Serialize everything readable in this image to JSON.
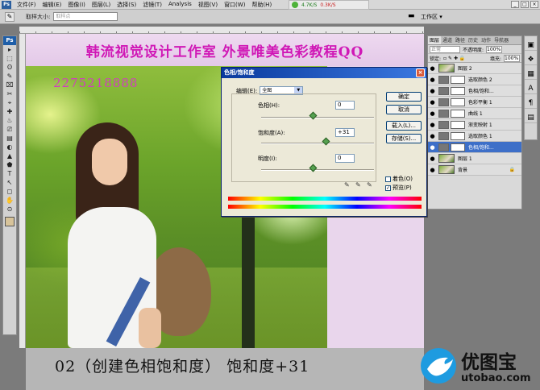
{
  "menubar": {
    "ps_icon": "Ps",
    "items": [
      "文件(F)",
      "编辑(E)",
      "图像(I)",
      "图层(L)",
      "选择(S)",
      "滤镜(T)",
      "Analysis",
      "视图(V)",
      "窗口(W)",
      "帮助(H)"
    ],
    "net_up": "4.7K/S",
    "net_down": "0.3K/S"
  },
  "optbar": {
    "sample_size_label": "取样大小:",
    "sample_size_value": "取样点",
    "workspace_label": "工作区 ▾"
  },
  "toolbox": {
    "logo": "Ps",
    "tools": [
      "▸",
      "⬚",
      "ʘ",
      "✎",
      "⌧",
      "✂",
      "⌖",
      "✚",
      "♨",
      "⎚",
      "▤",
      "◐",
      "▲",
      "⬟",
      "T",
      "↖",
      "◻",
      "✋",
      "⊙"
    ]
  },
  "document": {
    "banner_title": "韩流视觉设计工作室  外景唯美色彩教程QQ",
    "qq_number": "2275218888",
    "caption": "02（创建色相饱和度） 饱和度+31"
  },
  "layers_panel": {
    "tabs": [
      "图层",
      "通道",
      "路径",
      "历史",
      "动作",
      "导航器"
    ],
    "blend_mode": "正常",
    "opacity_label": "不透明度:",
    "opacity_value": "100%",
    "lock_label": "锁定:",
    "fill_label": "填充:",
    "fill_value": "100%",
    "layers": [
      {
        "name": "图层 2",
        "thumb": "photo",
        "selected": false
      },
      {
        "name": "选取颜色 2",
        "thumb": "adjust",
        "selected": false
      },
      {
        "name": "色相/饱和...",
        "thumb": "adjust",
        "selected": false
      },
      {
        "name": "色彩平衡 1",
        "thumb": "adjust",
        "selected": false
      },
      {
        "name": "曲线 1",
        "thumb": "adjust",
        "selected": false
      },
      {
        "name": "渐变映射 1",
        "thumb": "adjust",
        "selected": false
      },
      {
        "name": "选取颜色 1",
        "thumb": "adjust",
        "selected": false
      },
      {
        "name": "色相/饱和...",
        "thumb": "adjust",
        "selected": true
      },
      {
        "name": "图层 1",
        "thumb": "photo",
        "selected": false
      },
      {
        "name": "背景",
        "thumb": "photo",
        "selected": false,
        "locked": true
      }
    ]
  },
  "dock_icons": [
    "▣",
    "❖",
    "▦",
    "A",
    "¶",
    "▤"
  ],
  "dialog": {
    "title": "色相/饱和度",
    "edit_label": "编辑(E):",
    "edit_value": "全图",
    "hue_label": "色相(H):",
    "hue_value": "0",
    "saturation_label": "饱和度(A):",
    "saturation_value": "+31",
    "lightness_label": "明度(I):",
    "lightness_value": "0",
    "ok_label": "确定",
    "cancel_label": "取消",
    "load_label": "载入(L)...",
    "save_label": "存储(S)...",
    "colorize_label": "着色(O)",
    "colorize_checked": false,
    "preview_label": "预览(P)",
    "preview_checked": true
  },
  "watermark": {
    "brand": "优图宝",
    "url": "utobao.com",
    "color": "#1e9be0"
  }
}
